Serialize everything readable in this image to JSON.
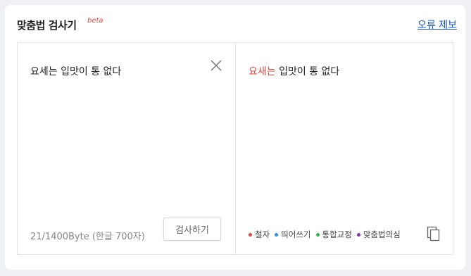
{
  "header": {
    "title": "맞춤법 검사기",
    "beta": "beta",
    "report_link": "오류 제보"
  },
  "input": {
    "text": "요세는 입맛이 통 없다",
    "counter": "21/1400Byte (한글 700자)",
    "check_button": "검사하기"
  },
  "result": {
    "error_word": "요새는",
    "rest_text": " 입맛이 통 없다"
  },
  "legend": [
    {
      "label": "철자",
      "color": "#e0443e"
    },
    {
      "label": "띄어쓰기",
      "color": "#2f8ee6"
    },
    {
      "label": "통합교정",
      "color": "#2cb34a"
    },
    {
      "label": "맞춤법의심",
      "color": "#8a2fb0"
    }
  ],
  "colors": {
    "accent_link": "#1a56c4",
    "error": "#e0443e"
  },
  "icons": {
    "clear": "close-icon",
    "copy": "copy-icon"
  }
}
